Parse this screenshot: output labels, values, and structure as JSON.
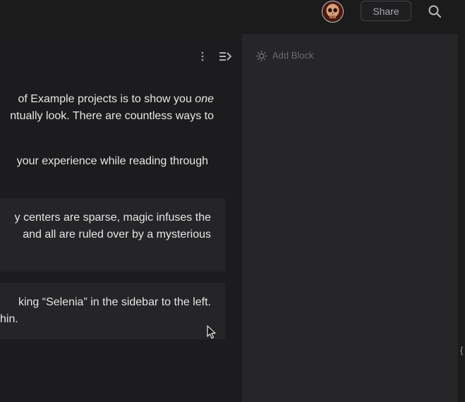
{
  "header": {
    "share_label": "Share",
    "avatar_icon": "skull-avatar-icon",
    "search_icon": "search-icon"
  },
  "content": {
    "menu_icon": "vertical-dots-icon",
    "collapse_icon": "collapse-panel-icon",
    "paragraph1": {
      "line1_prefix": "of Example projects is to show you ",
      "line1_emphasis": "one",
      "line2": "ntually look. There are countless ways to"
    },
    "paragraph2": {
      "line1": "your experience while reading through"
    },
    "card1": {
      "line1": "y centers are sparse, magic infuses the",
      "line2": "and all are ruled over by a mysterious"
    },
    "card2": {
      "line1": "king “Selenia” in the sidebar to the left.",
      "line2": "hin."
    }
  },
  "sidepanel": {
    "add_block_label": "Add Block",
    "add_block_icon": "gear-icon"
  },
  "edge_glyph": "{",
  "colors": {
    "background": "#1c1c1e",
    "topbar": "#1b1b1c",
    "card": "#252528",
    "sidepanel": "#262628",
    "text": "#e6e6e6",
    "muted": "#6b6b70"
  }
}
